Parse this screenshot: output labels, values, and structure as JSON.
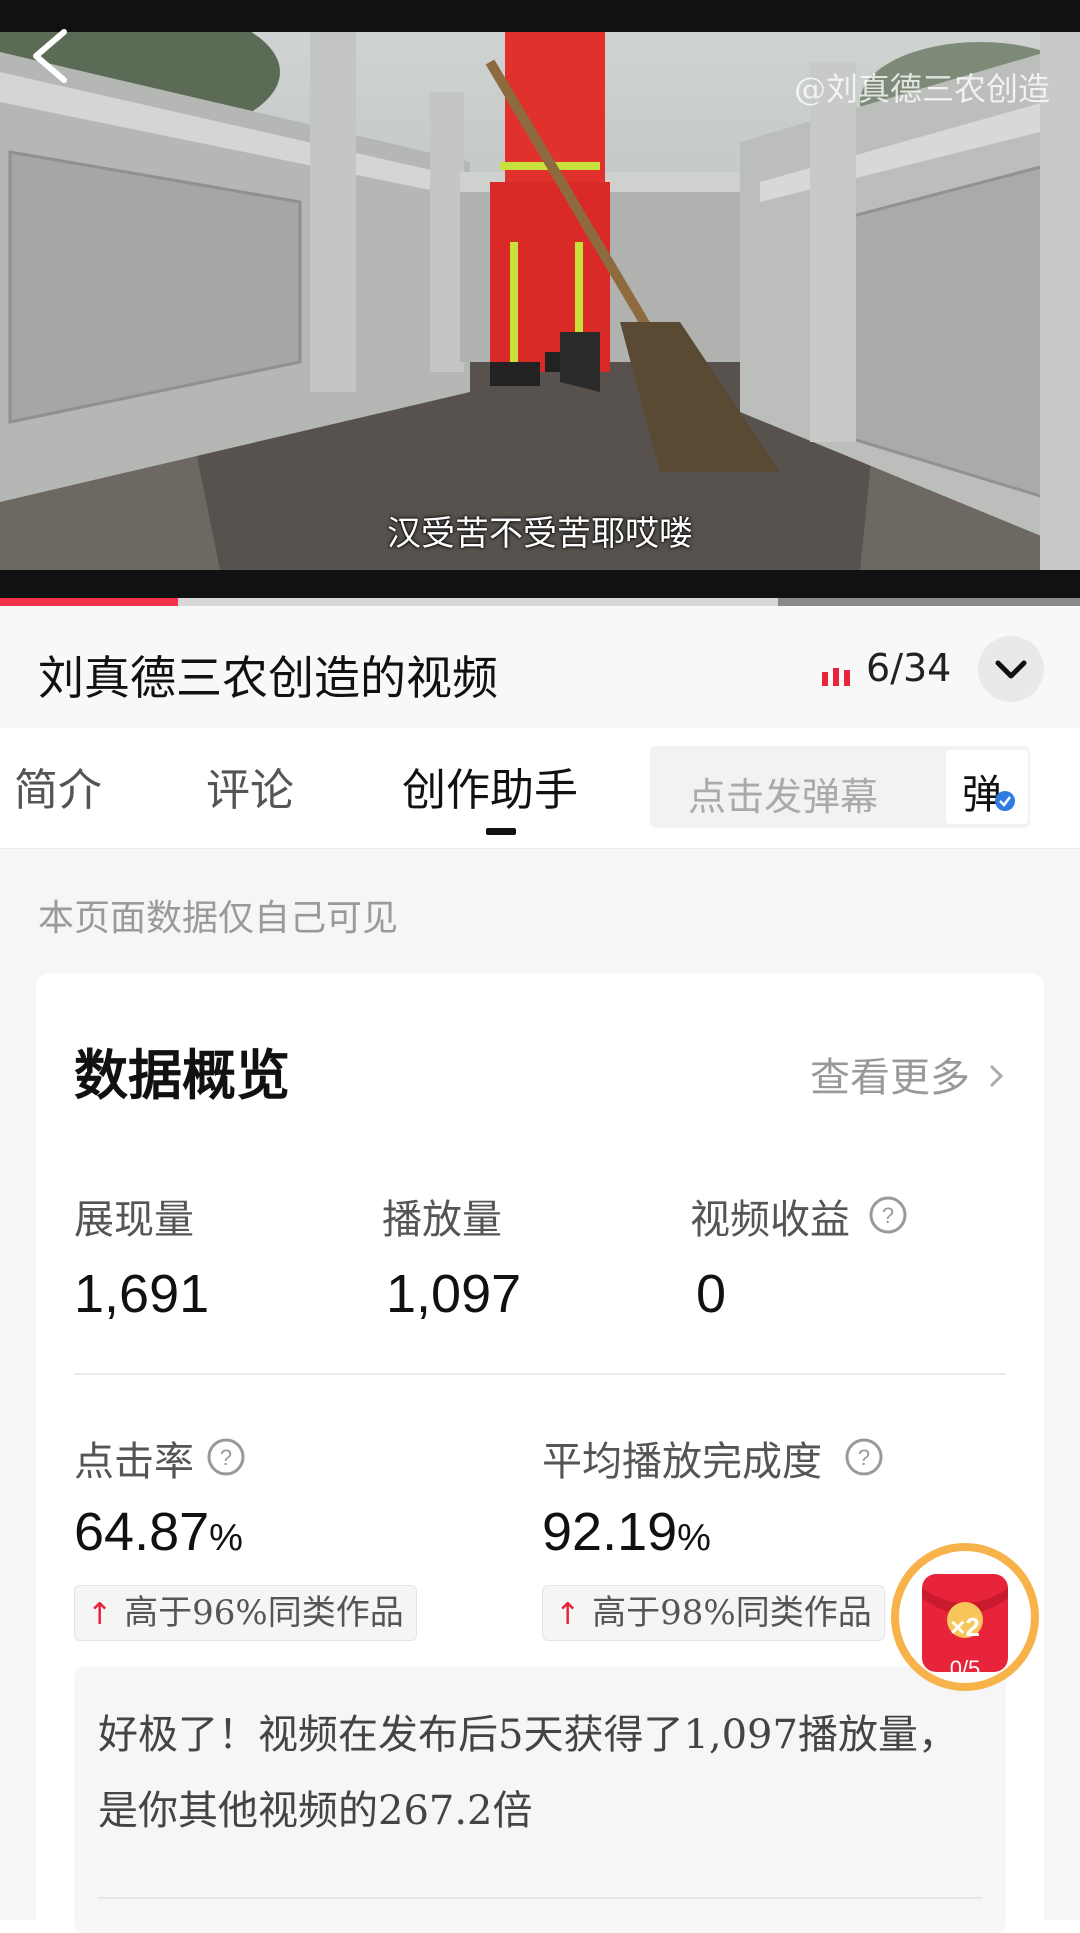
{
  "video": {
    "watermark": "@刘真德三农创造",
    "subtitle": "汉受苦不受苦耶哎喽",
    "progress_played": 0.165,
    "progress_buffered_from": 0.72
  },
  "header": {
    "title": "刘真德三农创造的视频",
    "episode_current": "6",
    "episode_total": "/34"
  },
  "tabs": [
    {
      "label": "简介"
    },
    {
      "label": "评论"
    },
    {
      "label": "创作助手"
    }
  ],
  "danmaku": {
    "placeholder": "点击发弹幕",
    "toggle_label": "弹"
  },
  "content": {
    "privacy_note": "本页面数据仅自己可见",
    "card_title": "数据概览",
    "more_label": "查看更多",
    "metrics_top": [
      {
        "label": "展现量",
        "value": "1,691"
      },
      {
        "label": "播放量",
        "value": "1,097"
      },
      {
        "label": "视频收益",
        "value": "0"
      }
    ],
    "metrics_bottom": [
      {
        "label": "点击率",
        "value": "64.87",
        "unit": "%",
        "compare": "高于96%同类作品"
      },
      {
        "label": "平均播放完成度",
        "value": "92.19",
        "unit": "%",
        "compare": "高于98%同类作品"
      }
    ],
    "insight": "好极了！视频在发布后5天获得了1,097播放量，是你其他视频的267.2倍"
  },
  "reward": {
    "multiplier": "×2",
    "progress": "0/5",
    "progress_fraction": 0.0
  },
  "colors": {
    "accent_red": "#e8243a",
    "progress_red": "#f0334a",
    "reward_ring": "#f7b24a"
  }
}
